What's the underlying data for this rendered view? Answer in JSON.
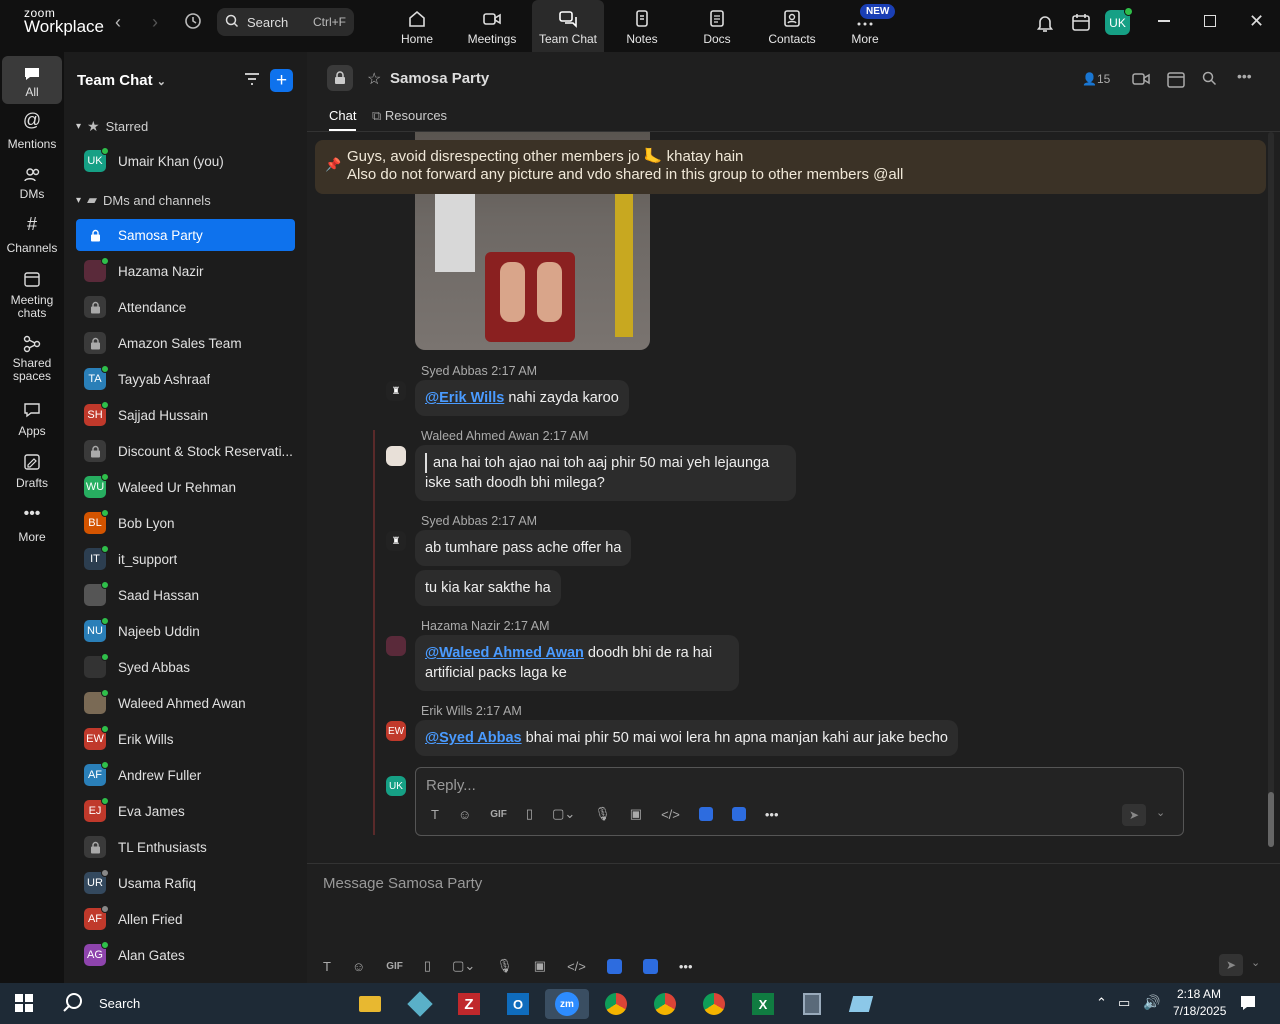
{
  "app": {
    "logo_small": "zoom",
    "logo_big": "Workplace"
  },
  "search": {
    "placeholder": "Search",
    "shortcut": "Ctrl+F"
  },
  "nav_tabs": [
    {
      "label": "Home",
      "icon": "home-icon"
    },
    {
      "label": "Meetings",
      "icon": "video-icon"
    },
    {
      "label": "Team Chat",
      "icon": "chat-icon",
      "active": true
    },
    {
      "label": "Notes",
      "icon": "notes-icon"
    },
    {
      "label": "Docs",
      "icon": "docs-icon"
    },
    {
      "label": "Contacts",
      "icon": "contacts-icon"
    },
    {
      "label": "More",
      "icon": "more-icon",
      "badge": "NEW"
    }
  ],
  "user": {
    "initials": "UK",
    "color": "#16a085"
  },
  "rail": [
    {
      "label": "All",
      "icon": "chat-bubble-icon",
      "active": true
    },
    {
      "label": "Mentions",
      "icon": "at-icon"
    },
    {
      "label": "DMs",
      "icon": "people-icon"
    },
    {
      "label": "Channels",
      "icon": "hash-icon"
    },
    {
      "label": "Meeting chats",
      "icon": "calendar-icon"
    },
    {
      "label": "Shared spaces",
      "icon": "share-icon"
    },
    {
      "label": "Apps",
      "icon": "apps-icon"
    },
    {
      "label": "Drafts",
      "icon": "drafts-icon"
    },
    {
      "label": "More",
      "icon": "ellipsis-icon"
    }
  ],
  "sidebar": {
    "title": "Team Chat",
    "starred_label": "Starred",
    "starred": [
      {
        "name": "Umair Khan (you)",
        "initials": "UK",
        "color": "#16a085",
        "status": "online"
      }
    ],
    "dms_label": "DMs and channels",
    "items": [
      {
        "name": "Samosa Party",
        "type": "lock",
        "active": true
      },
      {
        "name": "Hazama Nazir",
        "initials": "",
        "color": "#5a2a3a",
        "status": "online"
      },
      {
        "name": "Attendance",
        "type": "lock"
      },
      {
        "name": "Amazon Sales Team",
        "type": "lock"
      },
      {
        "name": "Tayyab Ashraaf",
        "initials": "TA",
        "color": "#2a7fb8",
        "status": "online"
      },
      {
        "name": "Sajjad Hussain",
        "initials": "SH",
        "color": "#c0392b",
        "status": "online"
      },
      {
        "name": "Discount & Stock Reservati...",
        "type": "lock"
      },
      {
        "name": "Waleed Ur Rehman",
        "initials": "WU",
        "color": "#27ae60",
        "status": "online"
      },
      {
        "name": "Bob Lyon",
        "initials": "BL",
        "color": "#d35400",
        "status": "online"
      },
      {
        "name": "it_support",
        "initials": "IT",
        "color": "#2c3e50",
        "status": "online"
      },
      {
        "name": "Saad Hassan",
        "initials": "",
        "color": "#555555",
        "status": "online"
      },
      {
        "name": "Najeeb Uddin",
        "initials": "NU",
        "color": "#2a7fb8",
        "status": "online"
      },
      {
        "name": "Syed Abbas",
        "initials": "",
        "color": "#333333",
        "status": "online"
      },
      {
        "name": "Waleed Ahmed Awan",
        "initials": "",
        "color": "#7a6a55",
        "status": "online"
      },
      {
        "name": "Erik Wills",
        "initials": "EW",
        "color": "#c0392b",
        "status": "online"
      },
      {
        "name": "Andrew Fuller",
        "initials": "AF",
        "color": "#2a7fb8",
        "status": "online"
      },
      {
        "name": "Eva James",
        "initials": "EJ",
        "color": "#c0392b",
        "status": "online"
      },
      {
        "name": "TL Enthusiasts",
        "type": "lock"
      },
      {
        "name": "Usama Rafiq",
        "initials": "UR",
        "color": "#34495e",
        "status": "away"
      },
      {
        "name": "Allen Fried",
        "initials": "AF",
        "color": "#c0392b",
        "status": "away"
      },
      {
        "name": "Alan Gates",
        "initials": "AG",
        "color": "#8e44ad",
        "status": "online"
      }
    ]
  },
  "channel": {
    "name": "Samosa Party",
    "member_count": "15",
    "tabs": [
      "Chat",
      "Resources"
    ],
    "pinned_line1": "Guys, avoid disrespecting other members jo 🦶 khatay hain",
    "pinned_line2": "Also do not forward any picture and vdo shared in this group to other members @all"
  },
  "messages": [
    {
      "author": "Syed Abbas",
      "time": "2:17 AM",
      "mention": "@Erik Wills",
      "text": " nahi zayda karoo"
    },
    {
      "author": "Waleed Ahmed Awan",
      "time": "2:17 AM",
      "line1": "ana hai toh ajao nai toh aaj phir 50 mai yeh lejaunga",
      "line2": "iske sath doodh bhi milega?"
    },
    {
      "author": "Syed Abbas",
      "time": "2:17 AM",
      "text1": "ab tumhare pass ache offer ha",
      "text2": "tu kia kar sakthe ha"
    },
    {
      "author": "Hazama Nazir",
      "time": "2:17 AM",
      "mention": "@Waleed Ahmed Awan",
      "text": " doodh bhi de ra hai",
      "line2": "artificial packs laga ke"
    },
    {
      "author": "Erik Wills",
      "time": "2:17 AM",
      "initials": "EW",
      "mention": "@Syed Abbas",
      "text": " bhai mai phir 50 mai woi lera hn apna manjan kahi aur jake becho"
    }
  ],
  "reply": {
    "placeholder": "Reply..."
  },
  "composer": {
    "placeholder": "Message Samosa Party"
  },
  "taskbar": {
    "search": "Search",
    "time": "2:18 AM",
    "date": "7/18/2025"
  }
}
